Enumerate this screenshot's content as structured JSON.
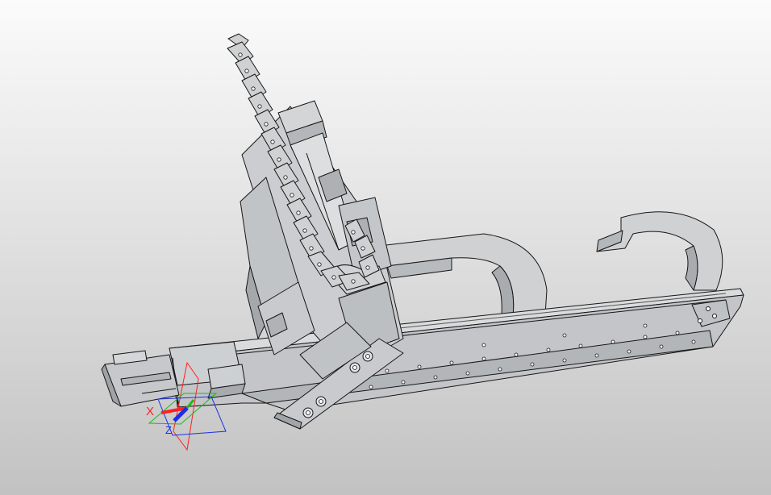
{
  "viewport": {
    "background_top": "#fbfbfb",
    "background_bottom": "#c2c2c2",
    "model_fill": "#c7c9cb",
    "model_light": "#d6d8da",
    "model_dark": "#a4a7aa",
    "edge_color": "#161616"
  },
  "triad": {
    "x_label": "X",
    "z_label": "Z",
    "x_color": "#ff2020",
    "y_color": "#1fb81f",
    "z_color": "#1f2fe0"
  }
}
